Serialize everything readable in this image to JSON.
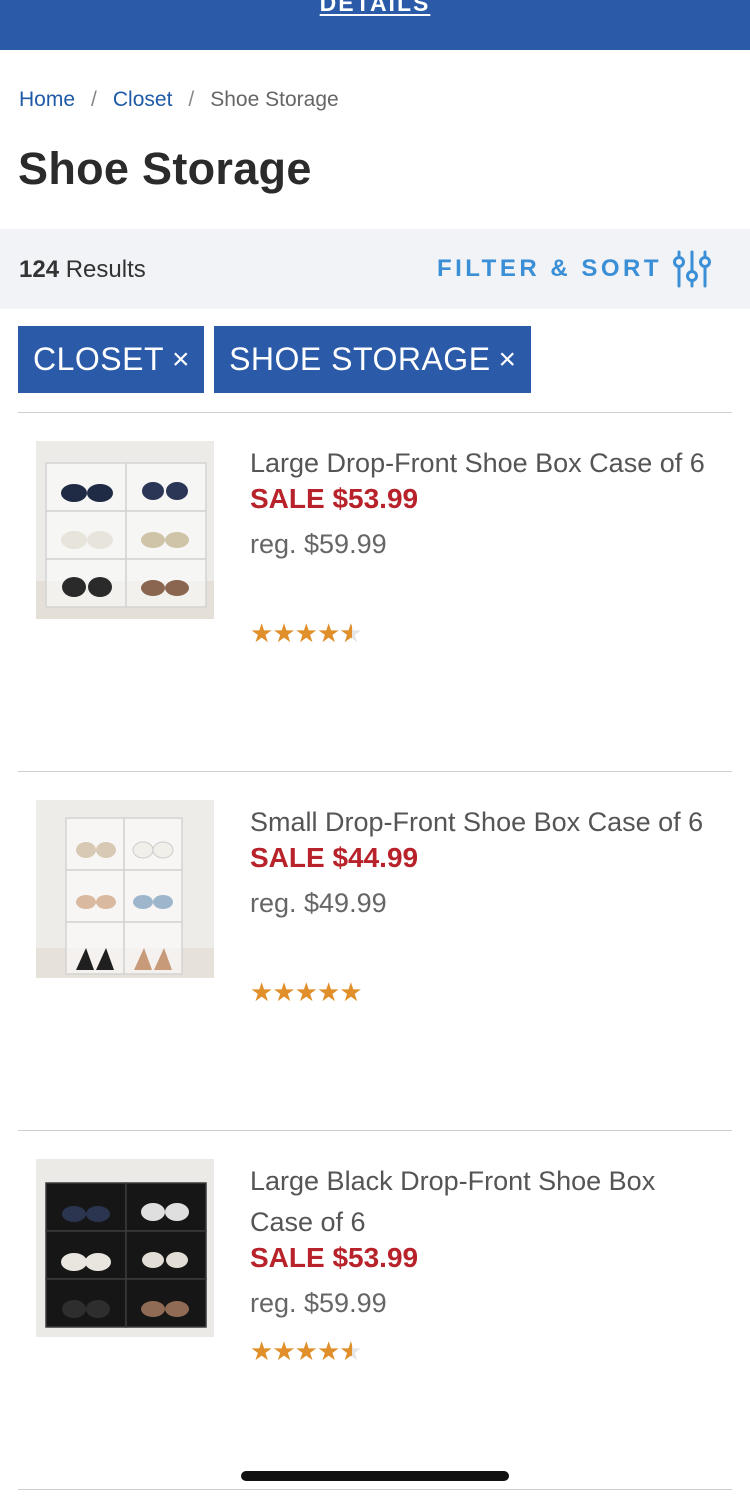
{
  "promo": {
    "link_label": "DETAILS"
  },
  "breadcrumb": {
    "items": [
      {
        "label": "Home"
      },
      {
        "label": "Closet"
      },
      {
        "label": "Shoe Storage"
      }
    ],
    "separator": "/"
  },
  "page_title": "Shoe Storage",
  "results": {
    "count": "124",
    "label": "Results"
  },
  "filter_sort": {
    "label": "FILTER & SORT",
    "icon": "sliders-icon"
  },
  "chips": [
    {
      "label": "CLOSET",
      "remove_icon": "×"
    },
    {
      "label": "SHOE STORAGE",
      "remove_icon": "×"
    }
  ],
  "products": [
    {
      "name": "Large Drop-Front Shoe Box Case of 6",
      "sale_price": "SALE $53.99",
      "reg_price": "reg. $59.99",
      "rating": 4.5,
      "image_style": "clear"
    },
    {
      "name": "Small Drop-Front Shoe Box Case of 6",
      "sale_price": "SALE $44.99",
      "reg_price": "reg. $49.99",
      "rating": 5,
      "image_style": "clear"
    },
    {
      "name": "Large Black Drop-Front Shoe Box Case of 6",
      "sale_price": "SALE $53.99",
      "reg_price": "reg. $59.99",
      "rating": 4.5,
      "image_style": "black"
    }
  ],
  "colors": {
    "brand_blue": "#2a5aa8",
    "link_blue": "#1f5aa6",
    "filter_blue": "#3a8fd6",
    "sale_red": "#b8222a",
    "star_orange": "#e08f2a"
  }
}
